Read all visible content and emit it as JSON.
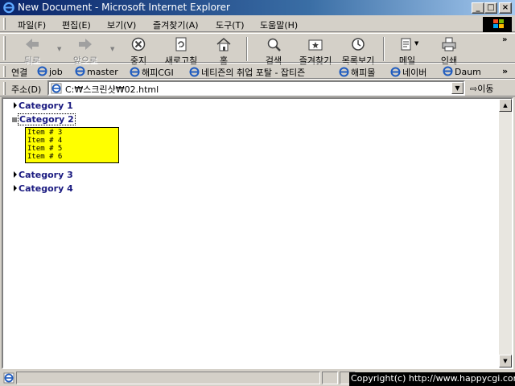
{
  "window": {
    "title": "New Document - Microsoft Internet Explorer",
    "minimize": "_",
    "maximize": "□",
    "close": "×"
  },
  "menubar": {
    "items": [
      "파일(F)",
      "편집(E)",
      "보기(V)",
      "즐겨찾기(A)",
      "도구(T)",
      "도움말(H)"
    ]
  },
  "toolbar": {
    "back": "뒤로",
    "forward": "앞으로",
    "stop": "중지",
    "refresh": "새로고침",
    "home": "홈",
    "search": "검색",
    "favorites": "즐겨찾기",
    "history": "목록보기",
    "mail": "메일",
    "print": "인쇄",
    "more": "»"
  },
  "links": {
    "label": "연결",
    "items": [
      "job",
      "master",
      "해피CGI",
      "네티즌의 취업 포탈 - 잡티즌",
      "해피몰",
      "네이버",
      "Daum"
    ],
    "more": "»"
  },
  "address": {
    "label": "주소(D)",
    "value": "C:₩스크린샷₩02.html",
    "go": "이동"
  },
  "page": {
    "categories": [
      {
        "label": "Category 1",
        "expanded": false
      },
      {
        "label": "Category 2",
        "expanded": true,
        "items": [
          "Item # 3",
          "Item # 4",
          "Item # 5",
          "Item # 6"
        ]
      },
      {
        "label": "Category 3",
        "expanded": false
      },
      {
        "label": "Category 4",
        "expanded": false
      }
    ]
  },
  "status": {
    "copyright": "Copyright(c) http://www.happycgi.com"
  },
  "colors": {
    "titlebar_start": "#0a246a",
    "titlebar_end": "#a6caf0",
    "category_text": "#1a1a80",
    "item_box_bg": "#ffff00",
    "chrome": "#d4d0c8"
  }
}
